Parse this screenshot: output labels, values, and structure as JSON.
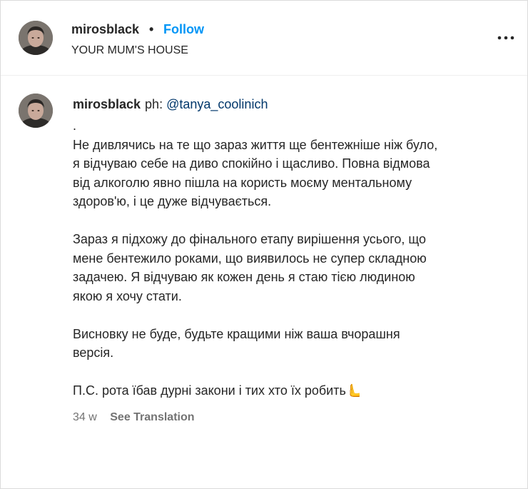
{
  "header": {
    "username": "mirosblack",
    "separator": "•",
    "follow_label": "Follow",
    "location": "YOUR MUM'S HOUSE",
    "more_icon": "more-horizontal-icon"
  },
  "caption": {
    "username": "mirosblack",
    "ph_label": "ph:",
    "mention": "@tanya_coolinich",
    "lines": [
      ".",
      "Не дивлячись на те що зараз життя ще бентежніше ніж було,",
      "я відчуваю себе на диво спокійно і щасливо. Повна відмова",
      "від алкоголю явно пішла на користь моєму ментальному",
      "здоров'ю, і це дуже відчувається.",
      "",
      "Зараз я підхожу до фінального етапу вирішення усього, що",
      "мене бентежило роками, що виявилось не супер складною",
      "задачею. Я відчуваю як кожен день я стаю тією людиною",
      "якою я хочу стати.",
      "",
      "Висновку не буде, будьте кращими ніж ваша вчорашня",
      "версія.",
      "",
      "П.С. рота їбав дурні закони і тих хто їх робить🫷"
    ],
    "time": "34 w",
    "see_translation": "See Translation"
  },
  "colors": {
    "follow": "#0095f6",
    "mention": "#00376b",
    "meta": "#737373",
    "text": "#262626"
  }
}
